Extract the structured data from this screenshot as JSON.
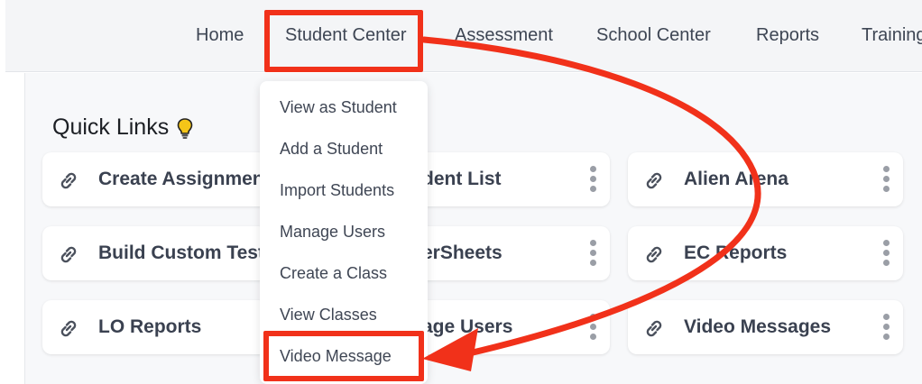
{
  "nav": {
    "items": [
      "Home",
      "Student Center",
      "Assessment",
      "School Center",
      "Reports",
      "Training"
    ]
  },
  "quick_links": {
    "title": "Quick Links",
    "cards": [
      {
        "label": "Create Assignment"
      },
      {
        "label": "dent List"
      },
      {
        "label": "Alien Arena"
      },
      {
        "label": "Build Custom Test"
      },
      {
        "label": "erSheets"
      },
      {
        "label": "EC Reports"
      },
      {
        "label": "LO Reports"
      },
      {
        "label": "age Users"
      },
      {
        "label": "Video Messages"
      }
    ]
  },
  "student_center_menu": {
    "items": [
      "View as Student",
      "Add a Student",
      "Import Students",
      "Manage Users",
      "Create a Class",
      "View Classes",
      "Video Message"
    ]
  },
  "colors": {
    "highlight": "#f1311a",
    "nav_bg": "#f4f5f7",
    "bulb": "#f5c518"
  },
  "icons": [
    "link-icon",
    "kebab-menu-icon",
    "lightbulb-icon",
    "curved-arrow-annotation"
  ]
}
